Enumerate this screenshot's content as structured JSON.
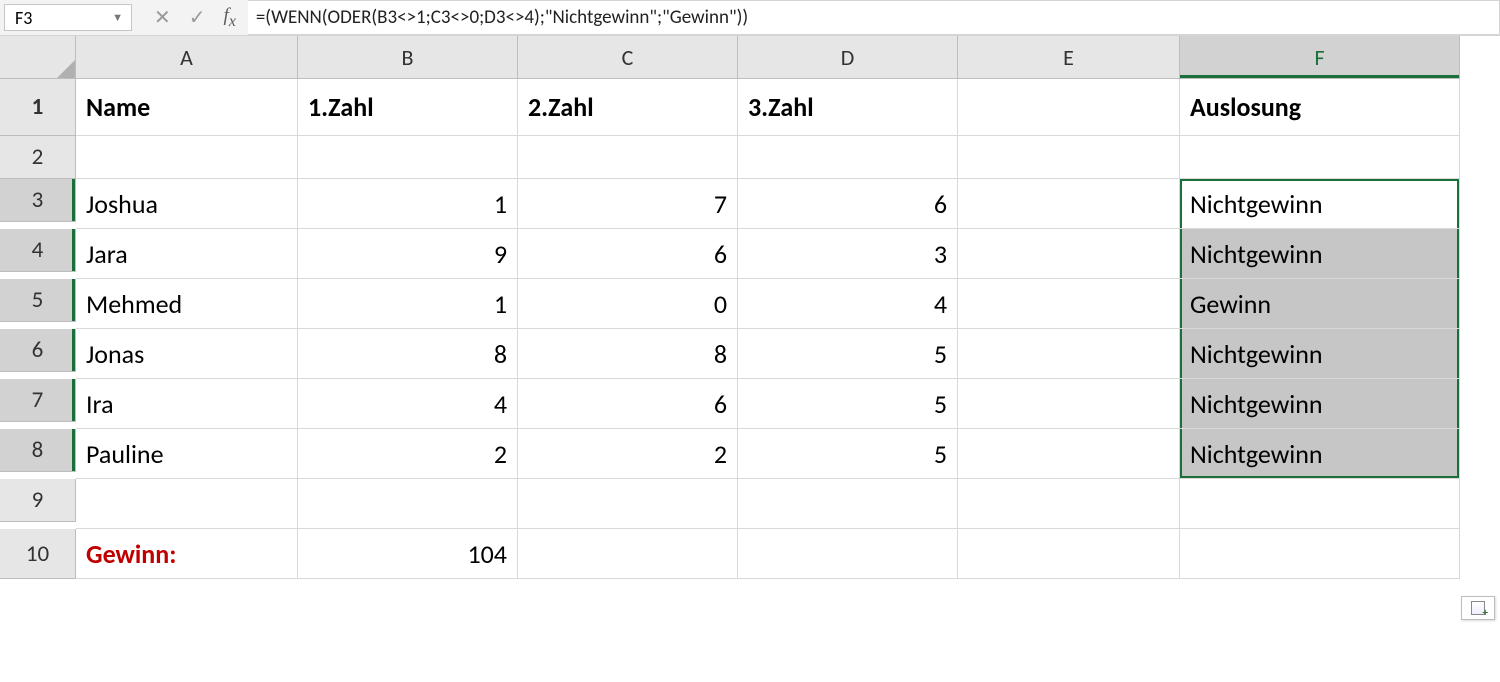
{
  "formula_bar": {
    "cell_ref": "F3",
    "formula": "=(WENN(ODER(B3<>1;C3<>0;D3<>4);\"Nichtgewinn\";\"Gewinn\"))"
  },
  "columns": [
    "A",
    "B",
    "C",
    "D",
    "E",
    "F"
  ],
  "row_numbers": [
    "1",
    "2",
    "3",
    "4",
    "5",
    "6",
    "7",
    "8",
    "9",
    "10"
  ],
  "headers": {
    "A": "Name",
    "B": "1.Zahl",
    "C": "2.Zahl",
    "D": "3.Zahl",
    "E": "",
    "F": "Auslosung"
  },
  "rows": [
    {
      "A": "Joshua",
      "B": "1",
      "C": "7",
      "D": "6",
      "E": "",
      "F": "Nichtgewinn"
    },
    {
      "A": "Jara",
      "B": "9",
      "C": "6",
      "D": "3",
      "E": "",
      "F": "Nichtgewinn"
    },
    {
      "A": "Mehmed",
      "B": "1",
      "C": "0",
      "D": "4",
      "E": "",
      "F": "Gewinn"
    },
    {
      "A": "Jonas",
      "B": "8",
      "C": "8",
      "D": "5",
      "E": "",
      "F": "Nichtgewinn"
    },
    {
      "A": "Ira",
      "B": "4",
      "C": "6",
      "D": "5",
      "E": "",
      "F": "Nichtgewinn"
    },
    {
      "A": "Pauline",
      "B": "2",
      "C": "2",
      "D": "5",
      "E": "",
      "F": "Nichtgewinn"
    }
  ],
  "footer": {
    "label": "Gewinn:",
    "value": "104"
  },
  "colors": {
    "accent": "#1a6f3b",
    "gewinn": "#c00000",
    "grid": "#d9d9d9",
    "header_bg": "#e6e6e6",
    "sel_fill": "#c6c6c6"
  }
}
